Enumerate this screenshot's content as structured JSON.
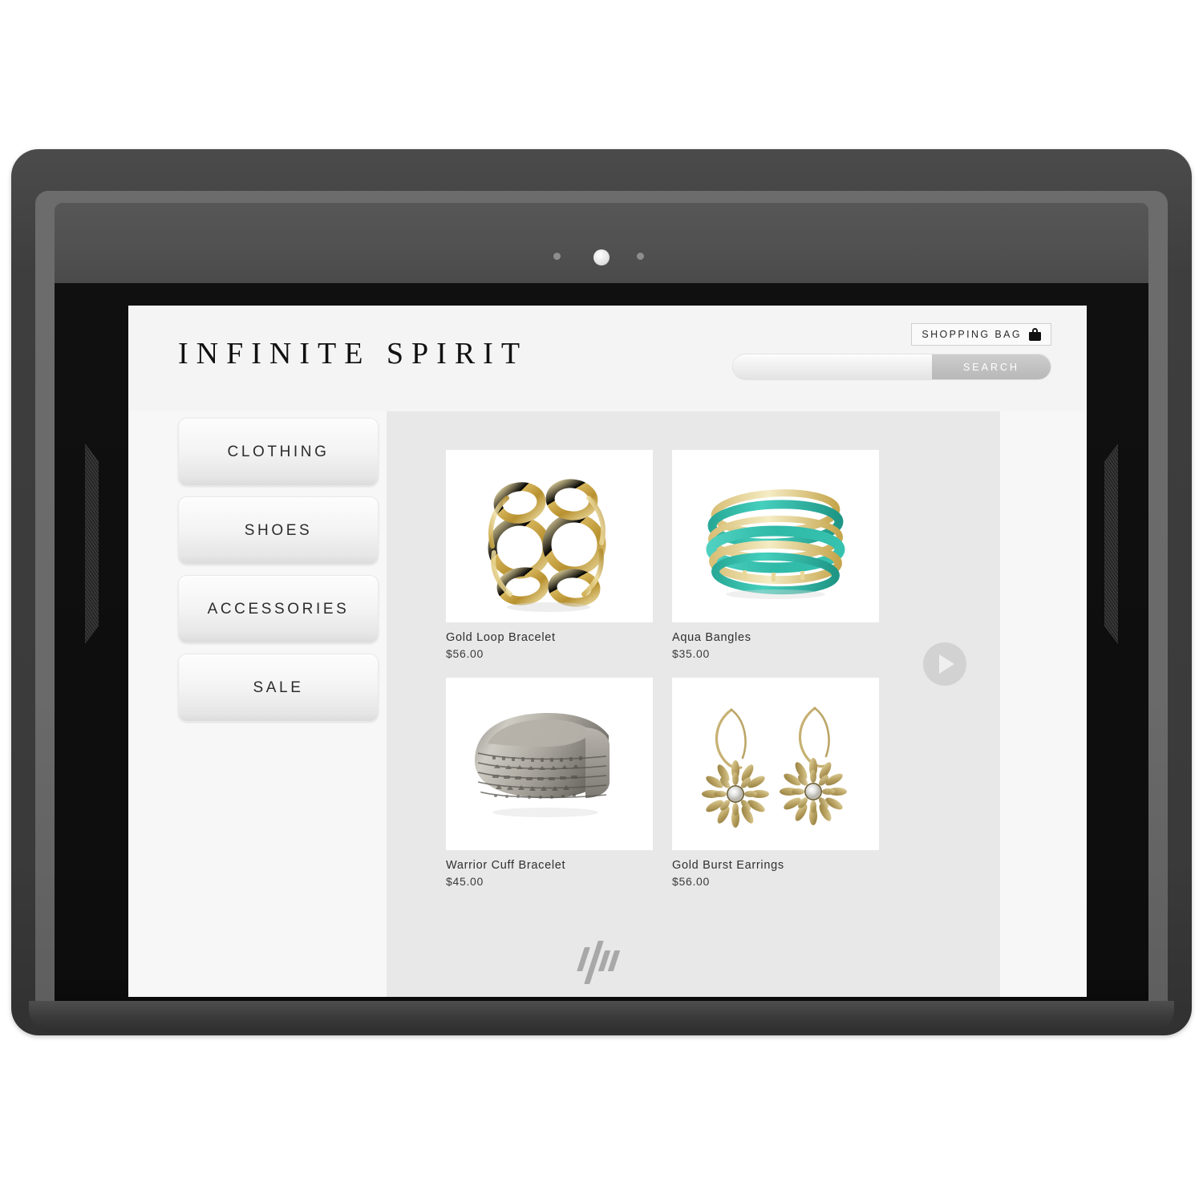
{
  "device": {
    "brand_logo": "hp-logo",
    "camera": "front-camera"
  },
  "site": {
    "brand": "INFINITE SPIRIT"
  },
  "header": {
    "shopping_bag_label": "SHOPPING BAG",
    "shopping_bag_icon": "shopping-bag-icon",
    "search_placeholder": "",
    "search_value": "",
    "search_button_label": "SEARCH"
  },
  "sidebar": {
    "items": [
      {
        "label": "CLOTHING"
      },
      {
        "label": "SHOES"
      },
      {
        "label": "ACCESSORIES"
      },
      {
        "label": "SALE"
      }
    ]
  },
  "products": [
    {
      "name": "Gold Loop Bracelet",
      "price": "$56.00",
      "art": "gold-loop-bracelet"
    },
    {
      "name": "Aqua Bangles",
      "price": "$35.00",
      "art": "aqua-bangles"
    },
    {
      "name": "Warrior Cuff Bracelet",
      "price": "$45.00",
      "art": "warrior-cuff-bracelet"
    },
    {
      "name": "Gold Burst Earrings",
      "price": "$56.00",
      "art": "gold-burst-earrings"
    }
  ],
  "carousel": {
    "next_icon": "play-triangle-icon"
  },
  "colors": {
    "page_bg": "#f4f4f4",
    "panel_bg": "#e8e8e8",
    "text": "#2c2c2c",
    "accent_teal": "#35bfae",
    "gold": "#c9a227"
  }
}
